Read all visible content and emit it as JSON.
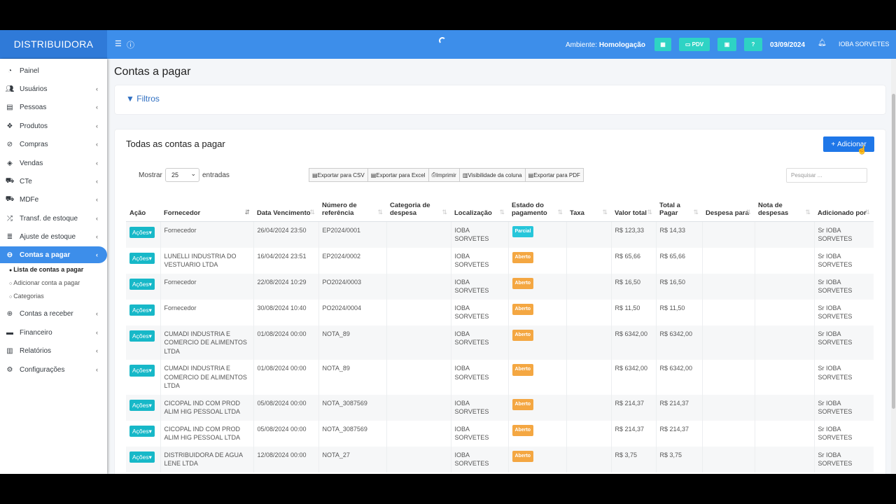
{
  "header": {
    "brand": "DISTRIBUIDORA",
    "env_label": "Ambiente:",
    "env_value": "Homologação",
    "pdv_label": "PDV",
    "date": "03/09/2024",
    "user": "IOBA SORVETES"
  },
  "sidebar": {
    "items": [
      {
        "label": "Painel",
        "icon": "dashboard-icon",
        "chevron": false
      },
      {
        "label": "Usuários",
        "icon": "users-icon",
        "chevron": true
      },
      {
        "label": "Pessoas",
        "icon": "address-book-icon",
        "chevron": true
      },
      {
        "label": "Produtos",
        "icon": "cubes-icon",
        "chevron": true
      },
      {
        "label": "Compras",
        "icon": "cart-icon",
        "chevron": true
      },
      {
        "label": "Vendas",
        "icon": "tag-icon",
        "chevron": true
      },
      {
        "label": "CTe",
        "icon": "truck-icon",
        "chevron": true
      },
      {
        "label": "MDFe",
        "icon": "truck-icon",
        "chevron": true
      },
      {
        "label": "Transf. de estoque",
        "icon": "shuffle-icon",
        "chevron": true
      },
      {
        "label": "Ajuste de estoque",
        "icon": "database-icon",
        "chevron": true
      },
      {
        "label": "Contas a pagar",
        "icon": "minus-circle-icon",
        "chevron": true,
        "active": true
      },
      {
        "label": "Contas a receber",
        "icon": "plus-circle-icon",
        "chevron": true
      },
      {
        "label": "Financeiro",
        "icon": "money-icon",
        "chevron": true
      },
      {
        "label": "Relatórios",
        "icon": "bar-chart-icon",
        "chevron": true
      },
      {
        "label": "Configurações",
        "icon": "gear-icon",
        "chevron": true
      }
    ],
    "subitems": [
      "Lista de contas a pagar",
      "Adicionar conta a pagar",
      "Categorias"
    ]
  },
  "page": {
    "title": "Contas a pagar",
    "filters_label": "Filtros",
    "card_title": "Todas as contas a pagar",
    "add_label": "Adicionar",
    "show_label": "Mostrar",
    "show_value": "25",
    "entries_label": "entradas",
    "search_placeholder": "Pesquisar ...",
    "export_buttons": [
      "Exportar para CSV",
      "Exportar para Excel",
      "Imprimir",
      "Visibilidade da coluna",
      "Exportar para PDF"
    ]
  },
  "table": {
    "columns": [
      "Ação",
      "Fornecedor",
      "Data Vencimento",
      "Número de referência",
      "Categoria de despesa",
      "Localização",
      "Estado do pagamento",
      "Taxa",
      "Valor total",
      "Total a Pagar",
      "Despesa para",
      "Nota de despesas",
      "Adicionado por"
    ],
    "action_label": "Ações",
    "rows": [
      {
        "fornecedor": "Fornecedor",
        "vencimento": "26/04/2024 23:50",
        "ref": "EP2024/0001",
        "categoria": "",
        "local": "IOBA SORVETES",
        "status": "Parcial",
        "status_color": "#26c6da",
        "taxa": "",
        "valor": "R$ 123,33",
        "pagar": "R$ 14,33",
        "despesa": "",
        "nota": "",
        "por": "Sr IOBA SORVETES"
      },
      {
        "fornecedor": "LUNELLI INDUSTRIA DO VESTUARIO LTDA",
        "vencimento": "16/04/2024 23:51",
        "ref": "EP2024/0002",
        "categoria": "",
        "local": "IOBA SORVETES",
        "status": "Aberto",
        "status_color": "#f4a742",
        "taxa": "",
        "valor": "R$ 65,66",
        "pagar": "R$ 65,66",
        "despesa": "",
        "nota": "",
        "por": "Sr IOBA SORVETES"
      },
      {
        "fornecedor": "Fornecedor",
        "vencimento": "22/08/2024 10:29",
        "ref": "PO2024/0003",
        "categoria": "",
        "local": "IOBA SORVETES",
        "status": "Aberto",
        "status_color": "#f4a742",
        "taxa": "",
        "valor": "R$ 16,50",
        "pagar": "R$ 16,50",
        "despesa": "",
        "nota": "",
        "por": "Sr IOBA SORVETES"
      },
      {
        "fornecedor": "Fornecedor",
        "vencimento": "30/08/2024 10:40",
        "ref": "PO2024/0004",
        "categoria": "",
        "local": "IOBA SORVETES",
        "status": "Aberto",
        "status_color": "#f4a742",
        "taxa": "",
        "valor": "R$ 11,50",
        "pagar": "R$ 11,50",
        "despesa": "",
        "nota": "",
        "por": "Sr IOBA SORVETES"
      },
      {
        "fornecedor": "CUMADI INDUSTRIA E COMERCIO DE ALIMENTOS LTDA",
        "vencimento": "01/08/2024 00:00",
        "ref": "NOTA_89",
        "categoria": "",
        "local": "IOBA SORVETES",
        "status": "Aberto",
        "status_color": "#f4a742",
        "taxa": "",
        "valor": "R$ 6342,00",
        "pagar": "R$ 6342,00",
        "despesa": "",
        "nota": "",
        "por": "Sr IOBA SORVETES"
      },
      {
        "fornecedor": "CUMADI INDUSTRIA E COMERCIO DE ALIMENTOS LTDA",
        "vencimento": "01/08/2024 00:00",
        "ref": "NOTA_89",
        "categoria": "",
        "local": "IOBA SORVETES",
        "status": "Aberto",
        "status_color": "#f4a742",
        "taxa": "",
        "valor": "R$ 6342,00",
        "pagar": "R$ 6342,00",
        "despesa": "",
        "nota": "",
        "por": "Sr IOBA SORVETES"
      },
      {
        "fornecedor": "CICOPAL IND COM PROD ALIM HIG PESSOAL LTDA",
        "vencimento": "05/08/2024 00:00",
        "ref": "NOTA_3087569",
        "categoria": "",
        "local": "IOBA SORVETES",
        "status": "Aberto",
        "status_color": "#f4a742",
        "taxa": "",
        "valor": "R$ 214,37",
        "pagar": "R$ 214,37",
        "despesa": "",
        "nota": "",
        "por": "Sr IOBA SORVETES"
      },
      {
        "fornecedor": "CICOPAL IND COM PROD ALIM HIG PESSOAL LTDA",
        "vencimento": "05/08/2024 00:00",
        "ref": "NOTA_3087569",
        "categoria": "",
        "local": "IOBA SORVETES",
        "status": "Aberto",
        "status_color": "#f4a742",
        "taxa": "",
        "valor": "R$ 214,37",
        "pagar": "R$ 214,37",
        "despesa": "",
        "nota": "",
        "por": "Sr IOBA SORVETES"
      },
      {
        "fornecedor": "DISTRIBUIDORA DE AGUA LENE LTDA",
        "vencimento": "12/08/2024 00:00",
        "ref": "NOTA_27",
        "categoria": "",
        "local": "IOBA SORVETES",
        "status": "Aberto",
        "status_color": "#f4a742",
        "taxa": "",
        "valor": "R$ 3,75",
        "pagar": "R$ 3,75",
        "despesa": "",
        "nota": "",
        "por": "Sr IOBA SORVETES"
      }
    ]
  }
}
